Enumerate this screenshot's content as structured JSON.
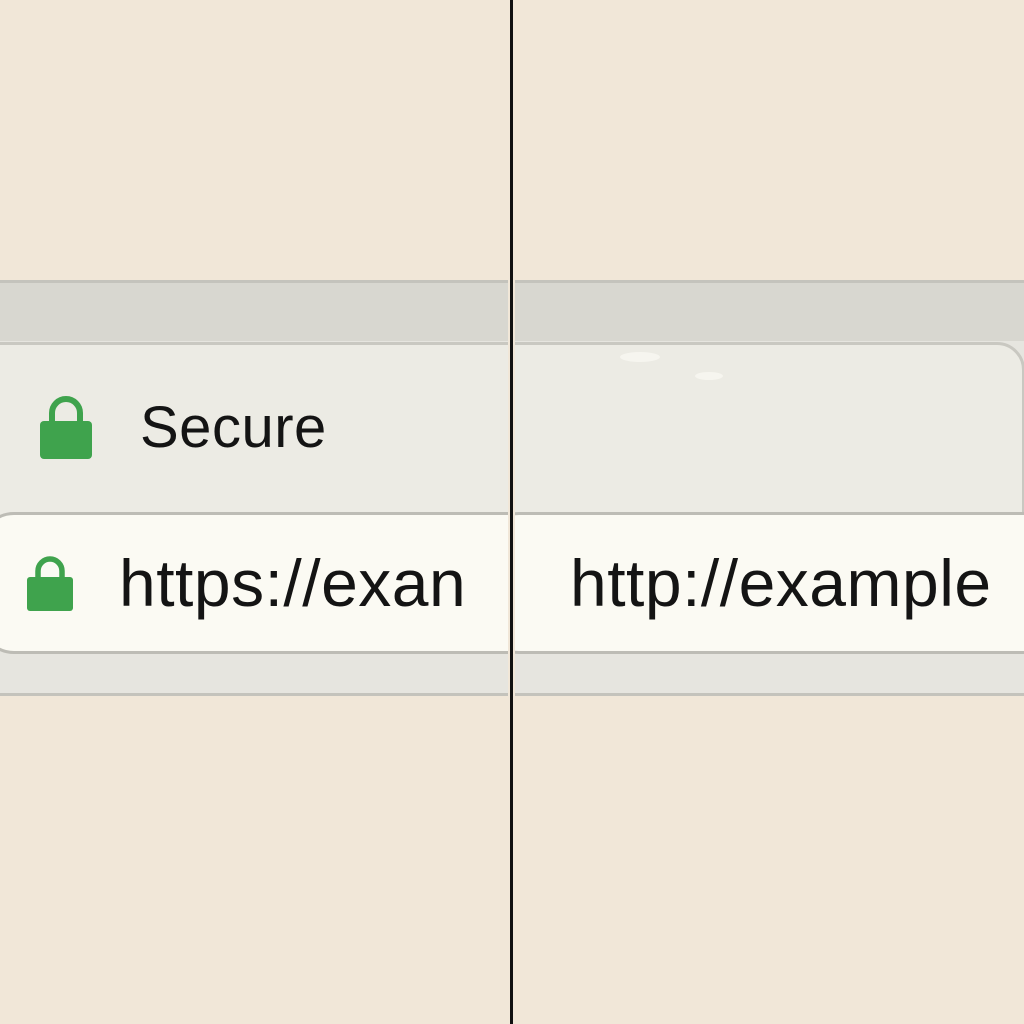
{
  "colors": {
    "background": "#f1e7d8",
    "toolbar": "#d8d7d0",
    "url_bar": "#fbfaf3",
    "lock_green": "#3fa34d",
    "divider": "#111111"
  },
  "left_panel": {
    "security_indicator": {
      "icon": "lock-icon",
      "label": "Secure"
    },
    "address_bar": {
      "icon": "lock-icon",
      "url": "https://exan"
    }
  },
  "right_panel": {
    "address_bar": {
      "url": "http://example"
    }
  }
}
